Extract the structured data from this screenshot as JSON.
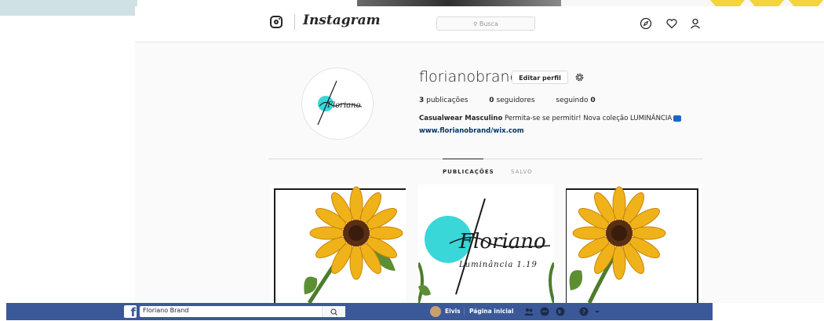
{
  "instagram": {
    "brand": "Instagram",
    "search_placeholder": "Busca",
    "profile": {
      "username": "florianobrand",
      "edit_button": "Editar perfil",
      "posts_count": "3",
      "posts_label": "publicações",
      "followers_count": "0",
      "followers_label": "seguidores",
      "following_label": "seguindo",
      "following_count": "0",
      "bio_name": "Casualwear Masculino",
      "bio_text": "Permita-se se permitir! Nova coleção LUMINÂNCIA",
      "website": "www.florianobrand/wix.com",
      "avatar_text": "Floriano"
    },
    "tabs": [
      {
        "label": "PUBLICAÇÕES"
      },
      {
        "label": "SALVO"
      }
    ],
    "posts": [
      {
        "kind": "sunflower"
      },
      {
        "kind": "logo",
        "logo_text": "Floriano",
        "sub_text": "Luminância 1.19"
      },
      {
        "kind": "sunflower"
      }
    ]
  },
  "facebook": {
    "search_value": "Floriano Brand",
    "user_name": "Elvis",
    "home_label": "Página inicial"
  },
  "colors": {
    "facebook_blue": "#3b5998",
    "accent_teal": "#39d7d8",
    "sunflower_yellow": "#f0b219"
  }
}
